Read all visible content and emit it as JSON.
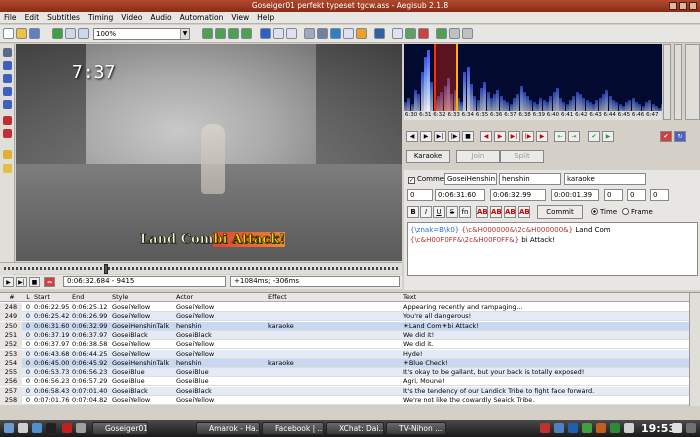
{
  "window": {
    "title": "Goseiger01 perfekt typeset tgcw.ass - Aegisub 2.1.8"
  },
  "menu": [
    "File",
    "Edit",
    "Subtitles",
    "Timing",
    "Video",
    "Audio",
    "Automation",
    "View",
    "Help"
  ],
  "toolbar": {
    "zoom": "100%"
  },
  "video": {
    "clock_overlay": "7:37",
    "subtitle_part1": "Land Com",
    "subtitle_part2": "bi Attack!",
    "time_display": "0:06:32.684 - 9415",
    "offset_display": "+1084ms; -306ms"
  },
  "audio": {
    "ruler": [
      "6:30",
      "6:31",
      "6:32",
      "6:33",
      "6:34",
      "6:35",
      "6:36",
      "6:37",
      "6:38",
      "6:39",
      "6:40",
      "6:41",
      "6:42",
      "6:43",
      "6:44",
      "6:45",
      "6:46",
      "6:47"
    ]
  },
  "karaoke": {
    "karaoke_label": "Karaoke",
    "join_label": "Join",
    "split_label": "Split"
  },
  "edit": {
    "comment_label": "Comment",
    "style": "GoseiHenshin",
    "actor": "henshin",
    "effect": "karaoke",
    "layer": "0",
    "start": "0:06:31.60",
    "end": "0:06:32.99",
    "duration": "0:00:01.39",
    "margin_l": "0",
    "margin_r": "0",
    "margin_v": "0",
    "commit_label": "Commit",
    "time_label": "Time",
    "frame_label": "Frame",
    "text_tag1": "{\\znak=B\\k0}",
    "text_code1": "{\\c&H000000&\\2c&H000000&}",
    "text_word1": "Land Com",
    "text_code2": "{\\c&H00F0FF&\\2c&H00F0FF&}",
    "text_word2": "bi Attack!"
  },
  "grid": {
    "headers": [
      "#",
      "L",
      "Start",
      "End",
      "Style",
      "Actor",
      "Effect",
      "Text"
    ],
    "rows": [
      [
        "248",
        "0",
        "0:06:22.95",
        "0:06:25.12",
        "GoseiYellow",
        "GoseiYellow",
        "",
        "Appearing recently and rampaging..."
      ],
      [
        "249",
        "0",
        "0:06:25.42",
        "0:06:26.99",
        "GoseiYellow",
        "GoseiYellow",
        "",
        "You're all dangerous!"
      ],
      [
        "250",
        "0",
        "0:06:31.60",
        "0:06:32.99",
        "GoseiHenshinTalk",
        "henshin",
        "karaoke",
        "☀Land Com☀bi Attack!"
      ],
      [
        "251",
        "0",
        "0:06:37.19",
        "0:06:37.97",
        "GoseiBlack",
        "GoseiBlack",
        "",
        "We did it!"
      ],
      [
        "252",
        "0",
        "0:06:37.97",
        "0:06:38.58",
        "GoseiYellow",
        "GoseiYellow",
        "",
        "We did it."
      ],
      [
        "253",
        "0",
        "0:06:43.68",
        "0:06:44.25",
        "GoseiYellow",
        "GoseiYellow",
        "",
        "Hyde!"
      ],
      [
        "254",
        "0",
        "0:06:45.00",
        "0:06:45.92",
        "GoseiHenshinTalk",
        "henshin",
        "karaoke",
        "☀Blue Check!"
      ],
      [
        "255",
        "0",
        "0:06:53.73",
        "0:06:56.23",
        "GoseiBlue",
        "GoseiBlue",
        "",
        "It's okay to be gallant, but your back is totally exposed!"
      ],
      [
        "256",
        "0",
        "0:06:56.23",
        "0:06:57.29",
        "GoseiBlue",
        "GoseiBlue",
        "",
        "Agri, Moune!"
      ],
      [
        "257",
        "0",
        "0:06:58.43",
        "0:07:01.40",
        "GoseiBlack",
        "GoseiBlack",
        "",
        "It's the tendency of our Landick Tribe to fight face forward."
      ],
      [
        "258",
        "0",
        "0:07:01.76",
        "0:07:04.82",
        "GoseiYellow",
        "GoseiYellow",
        "",
        "We're not like the cowardly Seaick Tribe."
      ]
    ]
  },
  "taskbar": {
    "tasks": [
      "Goseiger01 ...",
      "Amarok - Ha...",
      "Facebook | ...",
      "XChat: Dai...",
      "TV-Nihon ..."
    ],
    "clock": "19:53"
  },
  "colors": {
    "accent": "#b04a2e",
    "selection": "#c8d8f0",
    "audio_bg": "#030a30"
  }
}
